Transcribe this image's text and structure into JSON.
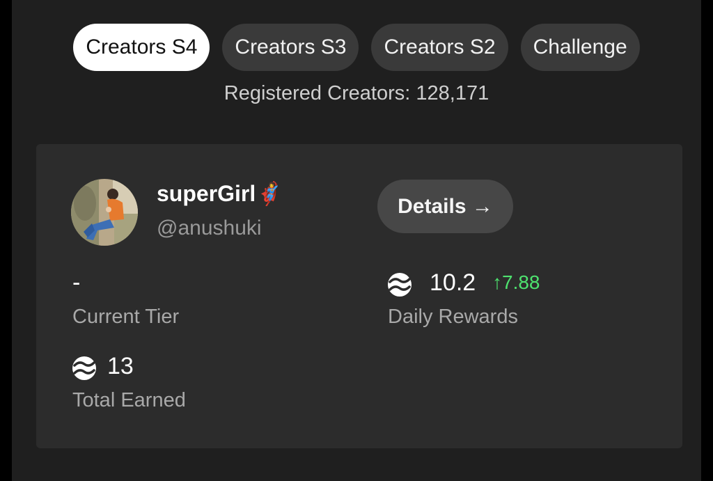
{
  "tabs": [
    {
      "label": "Creators S4",
      "active": true
    },
    {
      "label": "Creators S3",
      "active": false
    },
    {
      "label": "Creators S2",
      "active": false
    },
    {
      "label": "Challenge",
      "active": false
    }
  ],
  "registered_text": "Registered Creators: 128,171",
  "profile": {
    "display_name": "superGirl",
    "name_emoji": "🦸‍♀️",
    "handle": "@anushuki"
  },
  "details_button": {
    "label": "Details",
    "arrow": "→"
  },
  "stats": {
    "current_tier": {
      "value": "-",
      "label": "Current Tier"
    },
    "daily_rewards": {
      "value": "10.2",
      "delta": "↑7.88",
      "label": "Daily Rewards",
      "icon": "coin-icon"
    },
    "total_earned": {
      "value": "13",
      "label": "Total Earned",
      "icon": "coin-icon"
    }
  },
  "colors": {
    "background": "#1f1f1f",
    "card": "#2c2c2c",
    "active_tab": "#ffffff",
    "inactive_tab": "#3a3a3a",
    "positive": "#4ee36f"
  }
}
